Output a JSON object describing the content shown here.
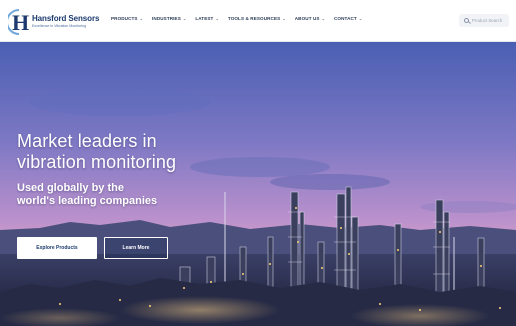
{
  "header": {
    "logo": {
      "name": "Hansford Sensors",
      "tagline": "Excellence in Vibration Monitoring",
      "letter": "H"
    },
    "nav": [
      {
        "label": "PRODUCTS",
        "has_dropdown": true
      },
      {
        "label": "INDUSTRIES",
        "has_dropdown": true
      },
      {
        "label": "LATEST",
        "has_dropdown": true
      },
      {
        "label": "TOOLS & RESOURCES",
        "has_dropdown": true
      },
      {
        "label": "ABOUT US",
        "has_dropdown": true
      },
      {
        "label": "CONTACT",
        "has_dropdown": true
      }
    ],
    "search": {
      "placeholder": "Product Search",
      "icon": "search-icon"
    }
  },
  "hero": {
    "headline_line1": "Market leaders in",
    "headline_line2": "vibration monitoring",
    "subline_line1": "Used globally by the",
    "subline_line2": "world's leading companies",
    "primary_button": "Explore Products",
    "secondary_button": "Learn More",
    "background": "refinery-at-dusk-photo"
  },
  "colors": {
    "brand_navy": "#1c3a6e",
    "nav_text": "#2b3b55",
    "sky_top": "#4d62b4",
    "sky_mid": "#b58bc8",
    "sky_horizon": "#f2b6c6"
  }
}
